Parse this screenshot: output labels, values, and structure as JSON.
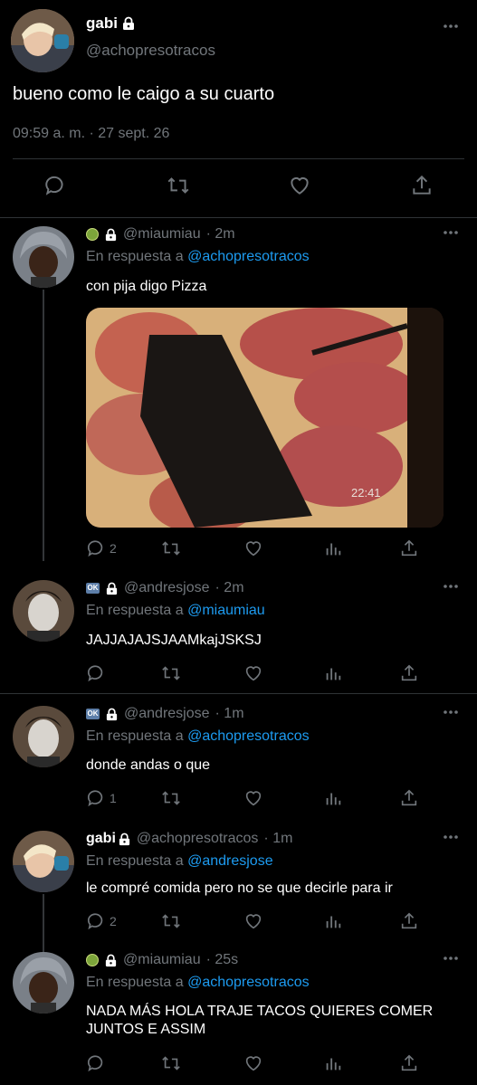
{
  "main_tweet": {
    "name": "gabi",
    "handle": "@achopresotracos",
    "text": "bueno como le caigo a su cuarto",
    "timestamp": "09:59 a. m. · 27 sept. 26"
  },
  "replies": [
    {
      "badge": "kiwi",
      "name": "",
      "handle": "@miaumiau",
      "time": "· 2m",
      "in_reply_prefix": "En respuesta a",
      "in_reply_to": "@achopresotracos",
      "text": "con pija digo Pizza",
      "media": {
        "timestamp": "22:41"
      },
      "reply_count": "2"
    },
    {
      "badge": "ok",
      "name": "",
      "handle": "@andresjose",
      "time": "· 2m",
      "in_reply_prefix": "En respuesta a",
      "in_reply_to": "@miaumiau",
      "text": "JAJJAJAJSJAAMkajJSKSJ",
      "reply_count": ""
    },
    {
      "badge": "ok",
      "name": "",
      "handle": "@andresjose",
      "time": "· 1m",
      "in_reply_prefix": "En respuesta a",
      "in_reply_to": "@achopresotracos",
      "text": "donde andas o que",
      "reply_count": "1"
    },
    {
      "badge": "",
      "name": "gabi",
      "handle": "@achopresotracos",
      "time": "· 1m",
      "in_reply_prefix": "En respuesta a",
      "in_reply_to": "@andresjose",
      "text": "le compré comida pero no se que decirle para ir",
      "reply_count": "2"
    },
    {
      "badge": "kiwi",
      "name": "",
      "handle": "@miaumiau",
      "time": "· 25s",
      "in_reply_prefix": "En respuesta a",
      "in_reply_to": "@achopresotracos",
      "text": "NADA MÁS HOLA TRAJE TACOS QUIERES COMER JUNTOS E ASSIM",
      "reply_count": ""
    }
  ],
  "colors": {
    "background": "#000000",
    "link": "#1d9bf0",
    "muted": "#71767b",
    "divider": "#2f3336"
  }
}
